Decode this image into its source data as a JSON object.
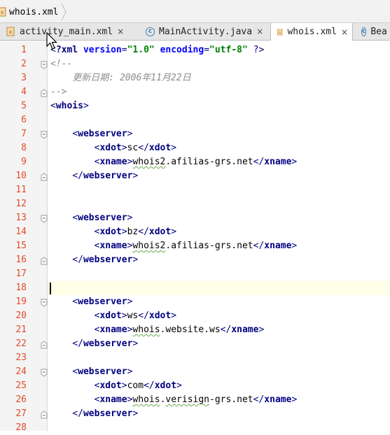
{
  "breadcrumb": {
    "file": "whois.xml"
  },
  "tabs": [
    {
      "label": "activity_main.xml",
      "icon": "xml-file-icon",
      "close": "×"
    },
    {
      "label": "MainActivity.java",
      "icon": "class-icon",
      "close": "×"
    },
    {
      "label": "whois.xml",
      "icon": "xml-file-icon",
      "close": "×",
      "active": true
    },
    {
      "label": "Bea",
      "icon": "class-icon"
    }
  ],
  "current_line": 18,
  "lines": [
    {
      "n": "1",
      "segs": [
        [
          "br",
          "<"
        ],
        [
          "tag",
          "?xml "
        ],
        [
          "attr",
          "version"
        ],
        [
          "br",
          "="
        ],
        [
          "val",
          "\"1.0\""
        ],
        [
          "txt",
          " "
        ],
        [
          "attr",
          "encoding"
        ],
        [
          "br",
          "="
        ],
        [
          "val",
          "\"utf-8\""
        ],
        [
          "txt",
          " "
        ],
        [
          "br",
          "?>"
        ]
      ]
    },
    {
      "n": "2",
      "segs": [
        [
          "cmt",
          "<!--"
        ]
      ]
    },
    {
      "n": "3",
      "segs": [
        [
          "cmt",
          "    更新日期: 2006年11月22日"
        ]
      ]
    },
    {
      "n": "4",
      "segs": [
        [
          "cmt",
          "-->"
        ]
      ]
    },
    {
      "n": "5",
      "segs": [
        [
          "br",
          "<"
        ],
        [
          "tag",
          "whois"
        ],
        [
          "br",
          ">"
        ]
      ]
    },
    {
      "n": "6",
      "segs": []
    },
    {
      "n": "7",
      "segs": [
        [
          "txt",
          "    "
        ],
        [
          "br",
          "<"
        ],
        [
          "tag",
          "webserver"
        ],
        [
          "br",
          ">"
        ]
      ]
    },
    {
      "n": "8",
      "segs": [
        [
          "txt",
          "        "
        ],
        [
          "br",
          "<"
        ],
        [
          "tag",
          "xdot"
        ],
        [
          "br",
          ">"
        ],
        [
          "txt",
          "sc"
        ],
        [
          "br",
          "</"
        ],
        [
          "tag",
          "xdot"
        ],
        [
          "br",
          ">"
        ]
      ]
    },
    {
      "n": "9",
      "segs": [
        [
          "txt",
          "        "
        ],
        [
          "br",
          "<"
        ],
        [
          "tag",
          "xname"
        ],
        [
          "br",
          ">"
        ],
        [
          "sq",
          "whois2"
        ],
        [
          "txt",
          ".afilias-grs.net"
        ],
        [
          "br",
          "</"
        ],
        [
          "tag",
          "xname"
        ],
        [
          "br",
          ">"
        ]
      ]
    },
    {
      "n": "10",
      "segs": [
        [
          "txt",
          "    "
        ],
        [
          "br",
          "</"
        ],
        [
          "tag",
          "webserver"
        ],
        [
          "br",
          ">"
        ]
      ]
    },
    {
      "n": "11",
      "segs": []
    },
    {
      "n": "12",
      "segs": []
    },
    {
      "n": "13",
      "segs": [
        [
          "txt",
          "    "
        ],
        [
          "br",
          "<"
        ],
        [
          "tag",
          "webserver"
        ],
        [
          "br",
          ">"
        ]
      ]
    },
    {
      "n": "14",
      "segs": [
        [
          "txt",
          "        "
        ],
        [
          "br",
          "<"
        ],
        [
          "tag",
          "xdot"
        ],
        [
          "br",
          ">"
        ],
        [
          "txt",
          "bz"
        ],
        [
          "br",
          "</"
        ],
        [
          "tag",
          "xdot"
        ],
        [
          "br",
          ">"
        ]
      ]
    },
    {
      "n": "15",
      "segs": [
        [
          "txt",
          "        "
        ],
        [
          "br",
          "<"
        ],
        [
          "tag",
          "xname"
        ],
        [
          "br",
          ">"
        ],
        [
          "sq",
          "whois2"
        ],
        [
          "txt",
          ".afilias-grs.net"
        ],
        [
          "br",
          "</"
        ],
        [
          "tag",
          "xname"
        ],
        [
          "br",
          ">"
        ]
      ]
    },
    {
      "n": "16",
      "segs": [
        [
          "txt",
          "    "
        ],
        [
          "br",
          "</"
        ],
        [
          "tag",
          "webserver"
        ],
        [
          "br",
          ">"
        ]
      ]
    },
    {
      "n": "17",
      "segs": []
    },
    {
      "n": "18",
      "segs": []
    },
    {
      "n": "19",
      "segs": [
        [
          "txt",
          "    "
        ],
        [
          "br",
          "<"
        ],
        [
          "tag",
          "webserver"
        ],
        [
          "br",
          ">"
        ]
      ]
    },
    {
      "n": "20",
      "segs": [
        [
          "txt",
          "        "
        ],
        [
          "br",
          "<"
        ],
        [
          "tag",
          "xdot"
        ],
        [
          "br",
          ">"
        ],
        [
          "txt",
          "ws"
        ],
        [
          "br",
          "</"
        ],
        [
          "tag",
          "xdot"
        ],
        [
          "br",
          ">"
        ]
      ]
    },
    {
      "n": "21",
      "segs": [
        [
          "txt",
          "        "
        ],
        [
          "br",
          "<"
        ],
        [
          "tag",
          "xname"
        ],
        [
          "br",
          ">"
        ],
        [
          "sq",
          "whois"
        ],
        [
          "txt",
          ".website.ws"
        ],
        [
          "br",
          "</"
        ],
        [
          "tag",
          "xname"
        ],
        [
          "br",
          ">"
        ]
      ]
    },
    {
      "n": "22",
      "segs": [
        [
          "txt",
          "    "
        ],
        [
          "br",
          "</"
        ],
        [
          "tag",
          "webserver"
        ],
        [
          "br",
          ">"
        ]
      ]
    },
    {
      "n": "23",
      "segs": []
    },
    {
      "n": "24",
      "segs": [
        [
          "txt",
          "    "
        ],
        [
          "br",
          "<"
        ],
        [
          "tag",
          "webserver"
        ],
        [
          "br",
          ">"
        ]
      ]
    },
    {
      "n": "25",
      "segs": [
        [
          "txt",
          "        "
        ],
        [
          "br",
          "<"
        ],
        [
          "tag",
          "xdot"
        ],
        [
          "br",
          ">"
        ],
        [
          "txt",
          "com"
        ],
        [
          "br",
          "</"
        ],
        [
          "tag",
          "xdot"
        ],
        [
          "br",
          ">"
        ]
      ]
    },
    {
      "n": "26",
      "segs": [
        [
          "txt",
          "        "
        ],
        [
          "br",
          "<"
        ],
        [
          "tag",
          "xname"
        ],
        [
          "br",
          ">"
        ],
        [
          "sq",
          "whois"
        ],
        [
          "txt",
          "."
        ],
        [
          "sq",
          "verisign"
        ],
        [
          "txt",
          "-grs.net"
        ],
        [
          "br",
          "</"
        ],
        [
          "tag",
          "xname"
        ],
        [
          "br",
          ">"
        ]
      ]
    },
    {
      "n": "27",
      "segs": [
        [
          "txt",
          "    "
        ],
        [
          "br",
          "</"
        ],
        [
          "tag",
          "webserver"
        ],
        [
          "br",
          ">"
        ]
      ]
    },
    {
      "n": "28",
      "segs": []
    }
  ],
  "folds": {
    "2": "open",
    "4": "close",
    "7": "open",
    "10": "close",
    "13": "open",
    "16": "close",
    "19": "open",
    "22": "close",
    "24": "open",
    "27": "close"
  }
}
